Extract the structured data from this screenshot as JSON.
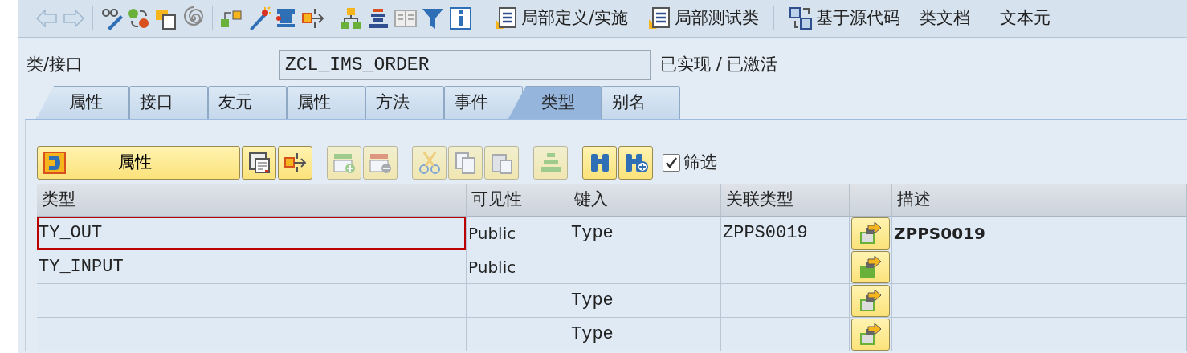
{
  "toolbar": {
    "text_buttons": [
      {
        "label": "局部定义/实施"
      },
      {
        "label": "局部测试类"
      },
      {
        "label": "基于源代码"
      },
      {
        "label": "类文档"
      },
      {
        "label": "文本元"
      }
    ]
  },
  "header": {
    "label": "类/接口",
    "value": "ZCL_IMS_ORDER",
    "status": "已实现 / 已激活"
  },
  "tabs": [
    {
      "label": "属性",
      "selected": false
    },
    {
      "label": "接口",
      "selected": false
    },
    {
      "label": "友元",
      "selected": false
    },
    {
      "label": "属性",
      "selected": false
    },
    {
      "label": "方法",
      "selected": false
    },
    {
      "label": "事件",
      "selected": false
    },
    {
      "label": "类型",
      "selected": true
    },
    {
      "label": "别名",
      "selected": false
    }
  ],
  "panel_toolbar": {
    "main_button": "属性",
    "filter": {
      "label": "筛选",
      "checked": true
    }
  },
  "table": {
    "columns": [
      "类型",
      "可见性",
      "键入",
      "关联类型",
      "描述"
    ],
    "rows": [
      {
        "name": "TY_OUT",
        "focused": true,
        "visibility": "Public",
        "typing": "Type",
        "associated_type": "ZPPS0019",
        "icon_filled": false,
        "description": "ZPPS0019"
      },
      {
        "name": "TY_INPUT",
        "focused": false,
        "visibility": "Public",
        "typing": "",
        "associated_type": "",
        "icon_filled": true,
        "description": ""
      },
      {
        "name": "",
        "focused": false,
        "visibility": "",
        "typing": "Type",
        "associated_type": "",
        "icon_filled": false,
        "description": ""
      },
      {
        "name": "",
        "focused": false,
        "visibility": "",
        "typing": "Type",
        "associated_type": "",
        "icon_filled": false,
        "description": ""
      }
    ]
  }
}
